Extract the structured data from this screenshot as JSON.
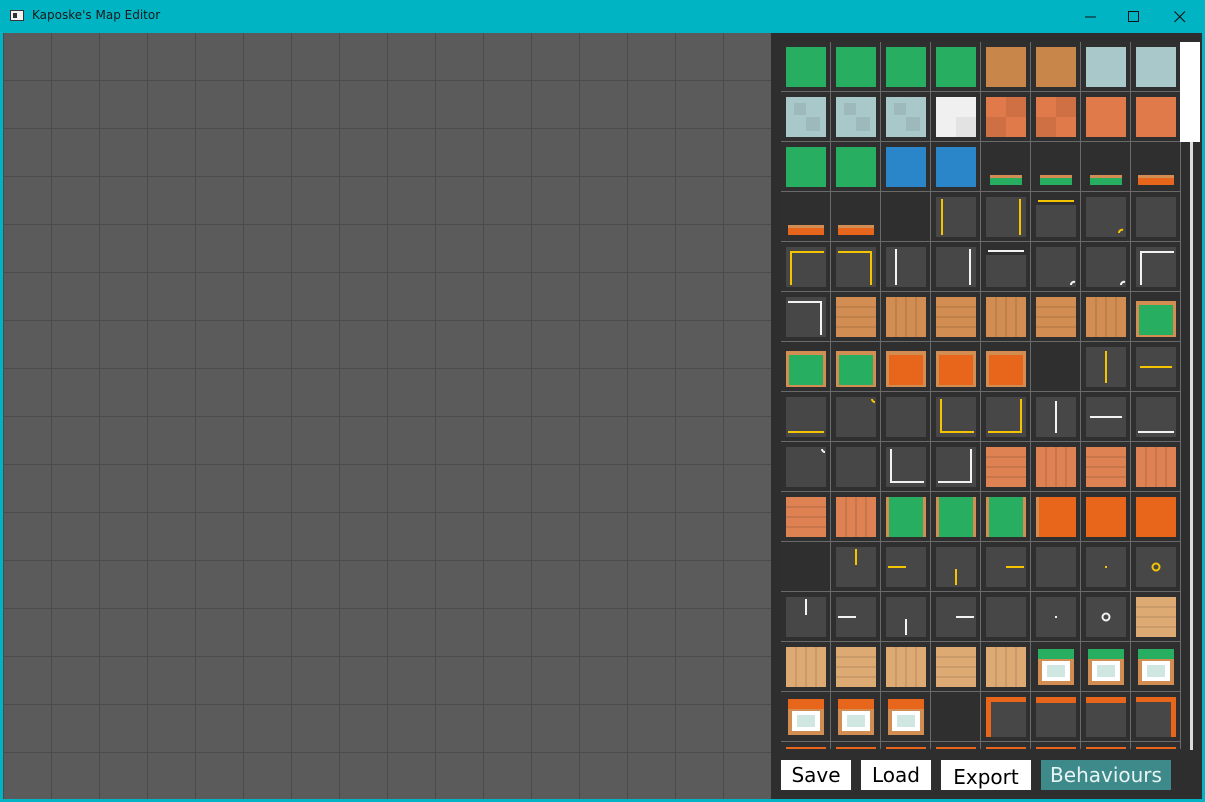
{
  "window": {
    "title": "Kaposke's Map Editor"
  },
  "buttons": {
    "save": "Save",
    "load": "Load",
    "export": "Export",
    "behaviours": "Behaviours"
  },
  "palette": {
    "columns": 8,
    "tiles": [
      "grass",
      "grass",
      "grass",
      "grass",
      "dirt",
      "dirt",
      "ice",
      "ice",
      "ice-pattern",
      "ice-pattern",
      "ice-pattern",
      "snow",
      "clay-pattern",
      "clay-pattern",
      "clay",
      "clay",
      "grass",
      "grass",
      "water",
      "water",
      "ledge-green",
      "ledge-green",
      "ledge-green",
      "ledge-orange",
      "ledge-orange",
      "ledge-orange",
      "empty",
      "line-yellow-left",
      "line-yellow-right",
      "line-yellow-top",
      "corner-yellow-dots",
      "line-grey",
      "corner-yellow-tl",
      "corner-yellow-tr",
      "line-white-left",
      "line-white-right",
      "line-white-top",
      "corner-white-dots",
      "corner-white-dots",
      "corner-white-tl",
      "corner-white-tr",
      "wood-h",
      "wood-v",
      "wood-h",
      "wood-v",
      "wood-h",
      "wood-v",
      "framed-grass",
      "framed-grass",
      "framed-grass",
      "framed-orange",
      "framed-orange",
      "framed-orange",
      "empty",
      "line-yellow-center-v",
      "line-yellow-center-h",
      "line-yellow-bottom",
      "corner-yellow-dots-top",
      "line-grey",
      "corner-yellow-bl",
      "corner-yellow-br",
      "line-white-center-v",
      "line-white-center-h",
      "line-white-bottom",
      "corner-white-dots-top",
      "line-grey",
      "corner-white-bl",
      "corner-white-br",
      "brick-h",
      "brick-v",
      "brick-h",
      "brick-v",
      "brick-h",
      "brick-v",
      "grass-sides",
      "grass-sides",
      "grass-sides",
      "orange-sides",
      "orange",
      "orange",
      "empty",
      "stub-yellow-top",
      "stub-yellow-left",
      "stub-yellow-bottom",
      "stub-yellow-right",
      "line-grey",
      "dot-yellow",
      "ring-yellow",
      "stub-white-top",
      "stub-white-left",
      "stub-white-bottom",
      "stub-white-right",
      "line-grey",
      "dot-white",
      "ring-white",
      "wood-light-h",
      "wood-light-v",
      "wood-light-h",
      "wood-light-v",
      "wood-light-h",
      "wood-light-v",
      "counter-green",
      "counter-green",
      "counter-green",
      "counter-orange",
      "counter-orange",
      "counter-orange",
      "empty",
      "frame-orange-tl",
      "frame-orange-t",
      "frame-orange-t",
      "frame-orange-tr",
      "strip-orange",
      "strip-orange",
      "strip-orange",
      "strip-orange",
      "strip-orange",
      "strip-orange",
      "strip-orange",
      "strip-orange"
    ]
  },
  "colors": {
    "titlebar": "#00b4c4",
    "map_background": "#5b5b5b",
    "panel_background": "#2e2e2e",
    "grass": "#27ae60",
    "dirt": "#c8864a",
    "ice": "#a9c8ca",
    "snow": "#f0f0f0",
    "clay": "#e07a4a",
    "water": "#2a86c8",
    "orange": "#e8661c",
    "yellow_line": "#f5c400",
    "white_line": "#f2f2f2",
    "wood": "#d28e52",
    "wood_light": "#ddaa74",
    "brick": "#de8254",
    "behaviours_button": "#3e8a8a"
  }
}
